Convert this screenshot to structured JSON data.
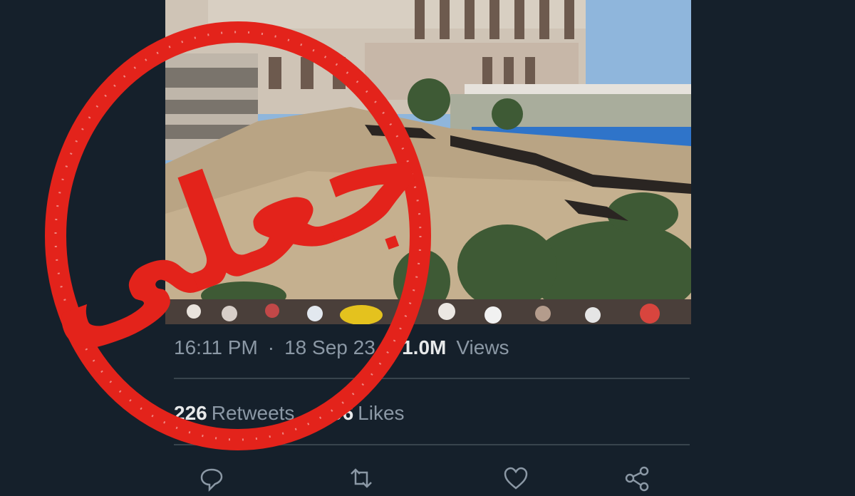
{
  "tweet": {
    "time": "16:11 PM",
    "date": "18 Sep 23",
    "views_count": "1.0M",
    "views_label": "Views",
    "retweets_count": "226",
    "retweets_label": "Retweets",
    "likes_count": "696",
    "likes_label": "Likes"
  },
  "stamp": {
    "text": "جعلی",
    "color": "#e3231b"
  },
  "actions": [
    {
      "icon": "reply-icon"
    },
    {
      "icon": "retweet-icon"
    },
    {
      "icon": "like-icon"
    },
    {
      "icon": "share-icon"
    }
  ],
  "colors": {
    "background": "#15202b",
    "secondary_text": "#8b98a5",
    "primary_text": "#e7e9ea",
    "divider": "#38444d"
  }
}
